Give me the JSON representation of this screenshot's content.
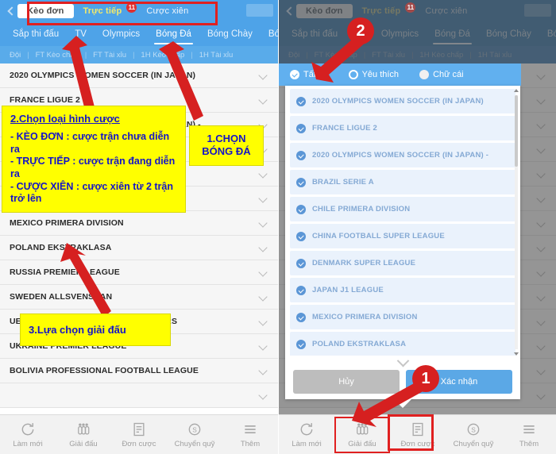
{
  "header": {
    "back_icon": "chevron-left-icon",
    "segments": [
      {
        "label": "Kèo đơn",
        "state": "active"
      },
      {
        "label": "Trực tiếp",
        "state": "live",
        "badge": "11"
      },
      {
        "label": "Cược xiên",
        "state": "plain"
      }
    ]
  },
  "sport_tabs": {
    "left": [
      "Sắp thi đấu",
      "TV",
      "Olympics",
      "Bóng Đá",
      "Bóng Chày",
      "Bóng"
    ],
    "right": [
      "Sắp thi đấu",
      "TV",
      "Olympics",
      "Bóng Đá",
      "Bóng Chày",
      "Bóng R"
    ],
    "active": "Bóng Đá"
  },
  "sub_tabs": [
    "Đội",
    "FT Kèo chấp",
    "FT Tài xỉu",
    "1H Kèo chấp",
    "1H Tài xỉu"
  ],
  "league_list": [
    "2020 OLYMPICS WOMEN SOCCER (IN JAPAN)",
    "FRANCE LIGUE 2",
    "2020 OLYMPICS WOMEN SOCCER (IN JAPAN) -",
    "BRAZIL SERIE A",
    "CHILE PRIMERA DIVISION",
    "CHINA FOOTBALL SUPER LEAGUE",
    "DENMARK SUPER LEAGUE",
    "JAPAN J1 LEAGUE",
    "MEXICO PRIMERA DIVISION",
    "POLAND EKSTRAKLASA",
    "RUSSIA PREMIER LEAGUE",
    "SWEDEN ALLSVENSKAN",
    "UEFA CHAMPIONS LEAGUE QUALIFIERS",
    "UKRAINE PREMIER LEAGUE",
    "BOLIVIA PROFESSIONAL FOOTBALL LEAGUE"
  ],
  "filter_bar": {
    "options": [
      {
        "label": "Tất cả",
        "selected": true,
        "icon": "radio-checked-icon"
      },
      {
        "label": "Yêu thích",
        "selected": false,
        "icon": "radio-ring-icon"
      },
      {
        "label": "Chữ cái",
        "selected": false,
        "icon": "radio-solid-icon"
      }
    ]
  },
  "modal": {
    "items": [
      "2020 OLYMPICS WOMEN SOCCER (IN JAPAN)",
      "FRANCE LIGUE 2",
      "2020 OLYMPICS WOMEN SOCCER (IN JAPAN) -",
      "BRAZIL SERIE A",
      "CHILE PRIMERA DIVISION",
      "CHINA FOOTBALL SUPER LEAGUE",
      "DENMARK SUPER LEAGUE",
      "JAPAN J1 LEAGUE",
      "MEXICO PRIMERA DIVISION",
      "POLAND EKSTRAKLASA"
    ],
    "cancel_label": "Hủy",
    "confirm_label": "Xác nhận"
  },
  "bottom_nav": [
    {
      "label": "Làm mới",
      "icon": "refresh-icon"
    },
    {
      "label": "Giải đấu",
      "icon": "league-icon"
    },
    {
      "label": "Đơn cược",
      "icon": "bet-slip-icon"
    },
    {
      "label": "Chuyển quỹ",
      "icon": "transfer-funds-icon"
    },
    {
      "label": "Thêm",
      "icon": "menu-icon"
    }
  ],
  "annotations": {
    "callout_bet_type": {
      "title": "2.Chọn loại hình cược",
      "lines": [
        "- KÈO ĐƠN :  cược trận chưa diễn ra",
        "- TRỰC TIẾP :  cược trận đang diễn ra",
        "- CƯỢC XIÊN : cược xiên từ 2 trận trở lên"
      ]
    },
    "callout_choose_football": "1.CHỌN BÓNG ĐÁ",
    "callout_choose_league": "3.Lựa chọn giải đấu",
    "bubble_one": "1",
    "bubble_two": "2"
  },
  "colors": {
    "header_blue": "#4ea3e8",
    "accent_red": "#e02020",
    "callout_yellow": "#ffff00",
    "callout_text": "#1414c8",
    "confirm_blue": "#5ba8e6"
  }
}
